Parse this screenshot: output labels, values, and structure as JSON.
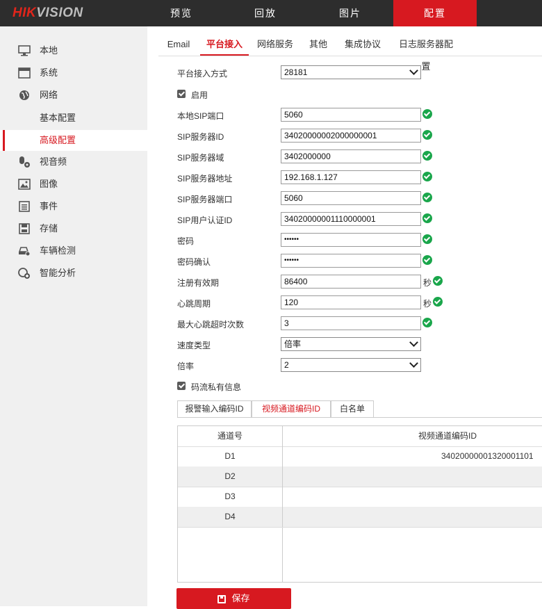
{
  "brand": {
    "logo_hik": "HIK",
    "logo_vision": "VISION"
  },
  "topnav": [
    {
      "label": "预览",
      "active": false
    },
    {
      "label": "回放",
      "active": false
    },
    {
      "label": "图片",
      "active": false
    },
    {
      "label": "配置",
      "active": true
    }
  ],
  "sidebar": {
    "items": [
      {
        "label": "本地",
        "icon": "monitor-icon"
      },
      {
        "label": "系统",
        "icon": "window-icon"
      },
      {
        "label": "网络",
        "icon": "globe-icon"
      },
      {
        "label": "基本配置",
        "icon": ""
      },
      {
        "label": "高级配置",
        "icon": "",
        "selected": true
      },
      {
        "label": "视音频",
        "icon": "mic-icon"
      },
      {
        "label": "图像",
        "icon": "image-icon"
      },
      {
        "label": "事件",
        "icon": "list-icon"
      },
      {
        "label": "存储",
        "icon": "disk-icon"
      },
      {
        "label": "车辆检测",
        "icon": "car-icon"
      },
      {
        "label": "智能分析",
        "icon": "analysis-icon"
      }
    ]
  },
  "tabs": [
    {
      "label": "Email"
    },
    {
      "label": "平台接入",
      "active": true
    },
    {
      "label": "网络服务"
    },
    {
      "label": "其他"
    },
    {
      "label": "集成协议"
    },
    {
      "label": "日志服务器配置"
    }
  ],
  "form": {
    "access_mode_label": "平台接入方式",
    "access_mode_value": "28181",
    "enable_label": "启用",
    "local_sip_port_label": "本地SIP端口",
    "local_sip_port": "5060",
    "sip_server_id_label": "SIP服务器ID",
    "sip_server_id": "34020000002000000001",
    "sip_server_domain_label": "SIP服务器域",
    "sip_server_domain": "3402000000",
    "sip_server_addr_label": "SIP服务器地址",
    "sip_server_addr": "192.168.1.127",
    "sip_server_port_label": "SIP服务器端口",
    "sip_server_port": "5060",
    "sip_user_id_label": "SIP用户认证ID",
    "sip_user_id": "34020000001110000001",
    "password_label": "密码",
    "password": "••••••",
    "password_confirm_label": "密码确认",
    "password_confirm": "••••••",
    "register_period_label": "注册有效期",
    "register_period": "86400",
    "heartbeat_label": "心跳周期",
    "heartbeat": "120",
    "seconds_unit": "秒",
    "max_timeout_label": "最大心跳超时次数",
    "max_timeout": "3",
    "speed_type_label": "速度类型",
    "speed_type": "倍率",
    "ratio_label": "倍率",
    "ratio": "2",
    "private_info_label": "码流私有信息"
  },
  "subtabs": [
    {
      "label": "报警输入编码ID"
    },
    {
      "label": "视频通道编码ID",
      "active": true
    },
    {
      "label": "白名单"
    }
  ],
  "table": {
    "headers": [
      "通道号",
      "视频通道编码ID"
    ],
    "rows": [
      {
        "channel": "D1",
        "id": "34020000001320001101"
      },
      {
        "channel": "D2",
        "id": ""
      },
      {
        "channel": "D3",
        "id": ""
      },
      {
        "channel": "D4",
        "id": ""
      }
    ]
  },
  "save_button": {
    "label": "保存",
    "icon": "floppy-icon"
  },
  "colors": {
    "accent": "#d71920",
    "topbar": "#2d2d2d",
    "sidebar": "#f0f0f0",
    "ok": "#1aa64b"
  }
}
